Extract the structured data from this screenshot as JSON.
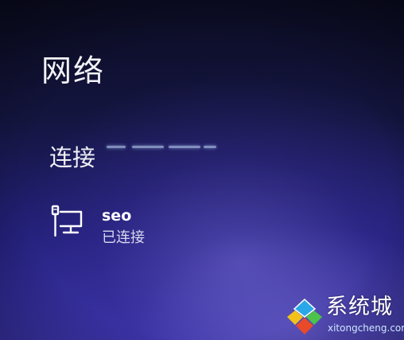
{
  "panel": {
    "title": "网络",
    "section_label": "连接"
  },
  "network": {
    "name": "seo",
    "status": "已连接",
    "icon": "wired-network-icon"
  },
  "watermark": {
    "text": "系统城",
    "url": "xitongcheng.com",
    "logo": "windows-logo-icon"
  },
  "colors": {
    "background_top": "#0b0c22",
    "background_bottom": "#3a33a8",
    "text": "#ffffff",
    "status_text": "#d8d8ec"
  }
}
